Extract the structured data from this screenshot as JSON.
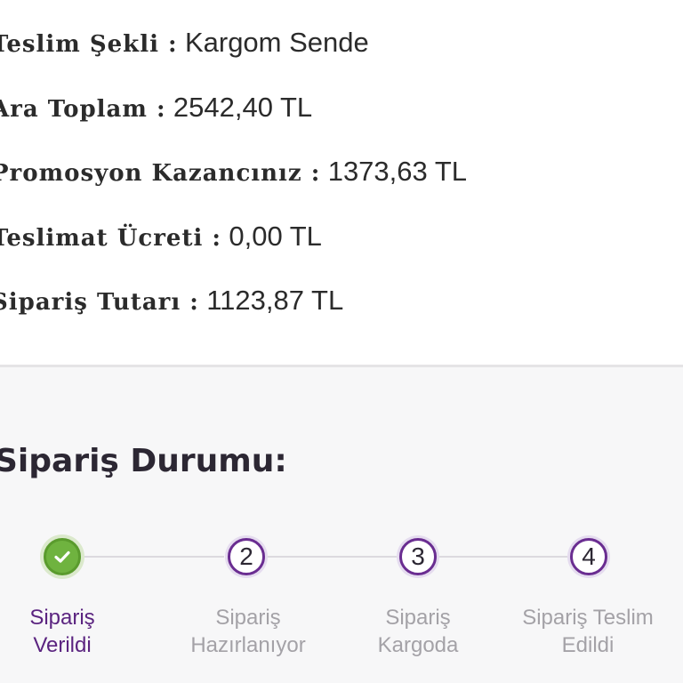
{
  "order_summary": {
    "rows": [
      {
        "label": "Teslim Şekli :",
        "value": "Kargom Sende"
      },
      {
        "label": "Ara Toplam :",
        "value": "2542,40 TL"
      },
      {
        "label": "Promosyon Kazancınız :",
        "value": "1373,63 TL"
      },
      {
        "label": "Teslimat Ücreti :",
        "value": "0,00 TL"
      },
      {
        "label": "Sipariş Tutarı :",
        "value": "1123,87 TL"
      }
    ]
  },
  "order_status": {
    "title": "Sipariş Durumu:",
    "steps": [
      {
        "marker": "",
        "icon": "check-icon",
        "line1": "Sipariş",
        "line2": "Verildi",
        "state": "completed"
      },
      {
        "marker": "2",
        "line1": "Sipariş",
        "line2": "Hazırlanıyor",
        "state": "pending"
      },
      {
        "marker": "3",
        "line1": "Sipariş",
        "line2": "Kargoda",
        "state": "pending"
      },
      {
        "marker": "4",
        "line1": "Sipariş Teslim",
        "line2": "Edildi",
        "state": "pending"
      }
    ]
  },
  "colors": {
    "completed": "#6fb33f",
    "accent": "#6a2d91",
    "active_label": "#5b2480",
    "inactive_label": "#a4a2a7"
  }
}
